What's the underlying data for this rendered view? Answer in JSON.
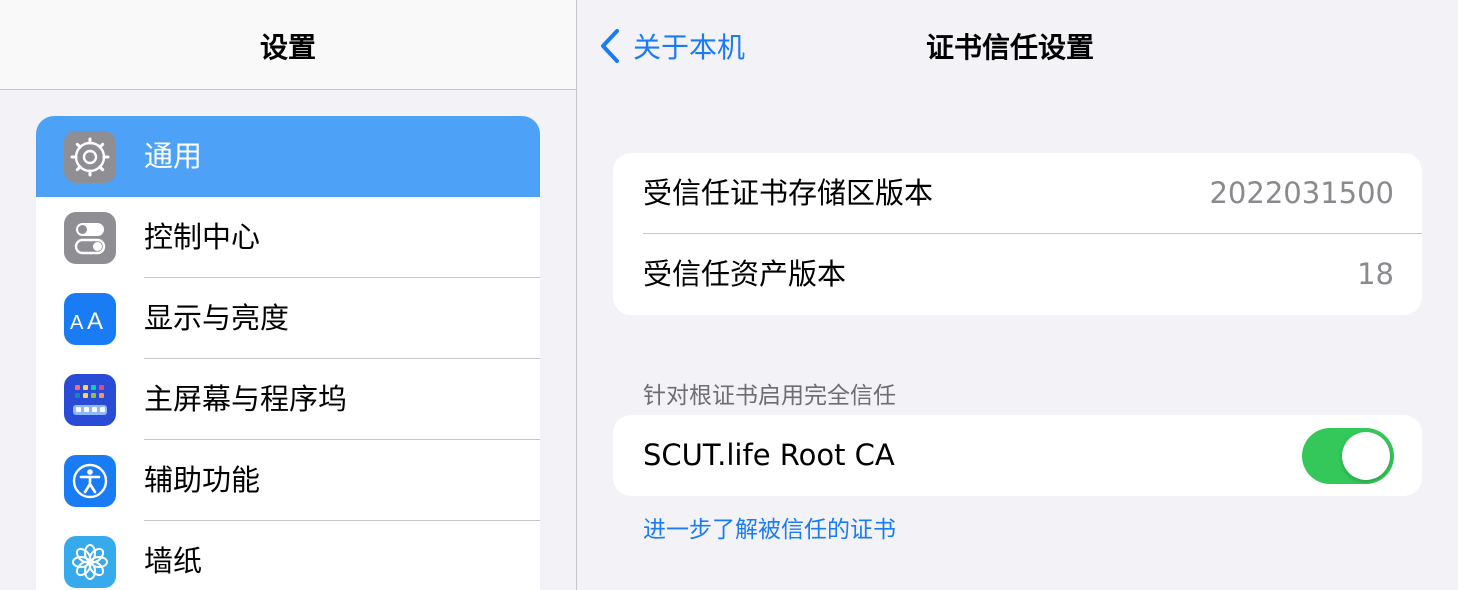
{
  "sidebar": {
    "title": "设置",
    "items": [
      {
        "label": "通用",
        "icon": "gear-icon",
        "color": "#8e8e93",
        "selected": true
      },
      {
        "label": "控制中心",
        "icon": "control-center-icon",
        "color": "#8e8e93"
      },
      {
        "label": "显示与亮度",
        "icon": "display-text-size-icon",
        "color": "#1a7cf5"
      },
      {
        "label": "主屏幕与程序坞",
        "icon": "home-screen-grid-icon",
        "color": "#2a4bd6"
      },
      {
        "label": "辅助功能",
        "icon": "accessibility-icon",
        "color": "#1a7cf5"
      },
      {
        "label": "墙纸",
        "icon": "wallpaper-flower-icon",
        "color": "#37a9ed"
      }
    ]
  },
  "detail": {
    "back_label": "关于本机",
    "title": "证书信任设置",
    "versions": [
      {
        "label": "受信任证书存储区版本",
        "value": "2022031500"
      },
      {
        "label": "受信任资产版本",
        "value": "18"
      }
    ],
    "section_header": "针对根证书启用完全信任",
    "root_ca": {
      "label": "SCUT.life Root CA",
      "enabled": true
    },
    "learn_more": "进一步了解被信任的证书"
  },
  "colors": {
    "accent": "#1a7cf5",
    "selected_row": "#4da2f8",
    "toggle_on": "#34c759",
    "background": "#f2f2f7"
  }
}
